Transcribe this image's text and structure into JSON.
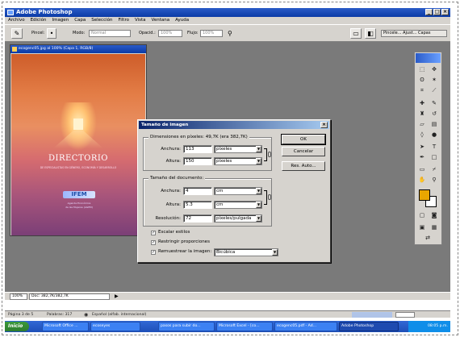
{
  "app": {
    "title": "Adobe Photoshop"
  },
  "menu": [
    "Archivo",
    "Edición",
    "Imagen",
    "Capa",
    "Selección",
    "Filtro",
    "Vista",
    "Ventana",
    "Ayuda"
  ],
  "options_bar": {
    "pincel_label": "Pincel:",
    "modo_label": "Modo:",
    "modo_value": "Normal",
    "opacidad_label": "Opacid.:",
    "opacidad_value": "100%",
    "flujo_label": "Flujo:",
    "flujo_value": "100%",
    "palettes": [
      "Pincele...",
      "Ajust...",
      "Capas"
    ]
  },
  "document": {
    "title": "ecogenc05.jpg al 100% (Capa 1, RGB/8)",
    "zoom": "100%",
    "doc_info": "Doc: 382,7K/382,7K",
    "content": {
      "heading": "DIRECTORIO",
      "subheading": "DE ESPECIALISTAS EN GÉNERO, ECONOMÍA Y DESARROLLO",
      "logo": "IFEM",
      "line1": "Agenda Económica",
      "line2": "de las Mujeres (AGEM)"
    }
  },
  "dialog": {
    "title": "Tamaño de imagen",
    "pixel_group_label": "Dimensiones en píxeles: 49,7K (era 382,7K)",
    "anchura_label": "Anchura:",
    "anchura_px": "113",
    "altura_label": "Altura:",
    "altura_px": "150",
    "unit_pixels": "píxeles",
    "doc_group_label": "Tamaño del documento:",
    "doc_anchura": "4",
    "doc_altura": "5.3",
    "unit_cm": "cm",
    "resolucion_label": "Resolución:",
    "resolucion_value": "72",
    "unit_ppi": "píxeles/pulgada",
    "ok_label": "OK",
    "cancel_label": "Cancelar",
    "auto_label": "Res. Auto...",
    "escalar_label": "Escalar estilos",
    "restringir_label": "Restringir proporciones",
    "remuestrear_label": "Remuestrear la imagen:",
    "remuestrear_value": "Bicúbica"
  },
  "word_status": {
    "pagina": "Página 3 de 5",
    "palabras": "Palabras: 317",
    "idioma": "Español (alfab. internacional)"
  },
  "taskbar": {
    "start": "Inicio",
    "tasks": [
      "Microsoft Office ...",
      "ecoseyes",
      "pasos para subir do...",
      "Microsoft Excel - [co...",
      "ecogenc05.pdf - Ad...",
      "Adobe Photoshop"
    ],
    "clock": "08:05 p.m."
  },
  "colors": {
    "titlebar": "#0a3aa6",
    "foreground": "#e9a600",
    "background": "#ffffff",
    "dialog_bg": "#d6d3ce"
  }
}
